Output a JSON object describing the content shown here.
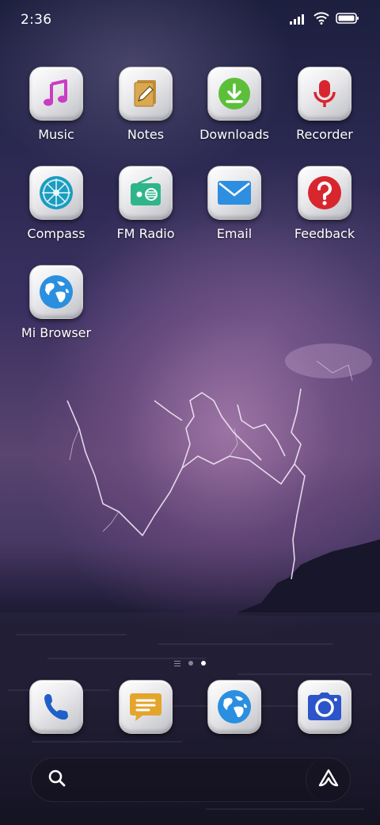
{
  "status_bar": {
    "time": "2:36",
    "icons": [
      "signal-icon",
      "wifi-icon",
      "battery-icon"
    ]
  },
  "apps": [
    {
      "label": "Music",
      "icon": "music-icon"
    },
    {
      "label": "Notes",
      "icon": "notes-icon"
    },
    {
      "label": "Downloads",
      "icon": "downloads-icon"
    },
    {
      "label": "Recorder",
      "icon": "recorder-icon"
    },
    {
      "label": "Compass",
      "icon": "compass-icon"
    },
    {
      "label": "FM Radio",
      "icon": "radio-icon"
    },
    {
      "label": "Email",
      "icon": "email-icon"
    },
    {
      "label": "Feedback",
      "icon": "feedback-icon"
    },
    {
      "label": "Mi Browser",
      "icon": "browser-icon"
    }
  ],
  "page_indicator": {
    "pages": 2,
    "active": 2
  },
  "dock": [
    {
      "icon": "phone-icon"
    },
    {
      "icon": "messages-icon"
    },
    {
      "icon": "browser-icon"
    },
    {
      "icon": "camera-icon"
    }
  ],
  "search_bar": {
    "left_icon": "search-icon",
    "right_icon": "assistant-icon"
  },
  "colors": {
    "music": "#c93cc3",
    "notes": "#d9a850",
    "downloads": "#5cbf3a",
    "recorder": "#d8262e",
    "compass": "#1b9cc0",
    "radio": "#2fb58a",
    "email": "#2e8fe0",
    "feedback": "#d8262e",
    "browser": "#2a8fe0",
    "phone": "#1f5fc7",
    "messages": "#e4a52c",
    "camera": "#2b55c9"
  }
}
